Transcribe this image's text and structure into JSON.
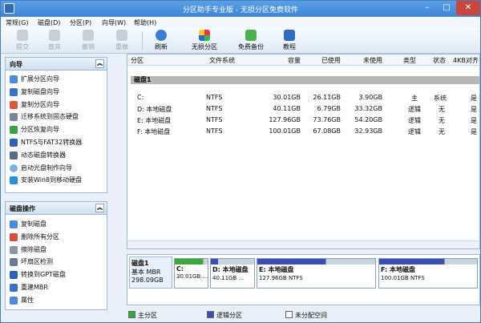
{
  "window": {
    "title": "分区助手专业版 - 无损分区免费软件"
  },
  "menu": [
    "常规(G)",
    "磁盘(D)",
    "分区(P)",
    "向导(W)",
    "帮助(H)"
  ],
  "toolbar": [
    {
      "label": "提交",
      "icon": "check-icon",
      "disabled": true
    },
    {
      "label": "放弃",
      "icon": "discard-icon",
      "disabled": true
    },
    {
      "label": "撤销",
      "icon": "undo-icon",
      "disabled": true
    },
    {
      "label": "重做",
      "icon": "redo-icon",
      "disabled": true
    },
    {
      "label": "刷新",
      "icon": "refresh-icon",
      "disabled": false
    },
    {
      "label": "无损分区",
      "icon": "partition-icon",
      "disabled": false
    },
    {
      "label": "免费备份",
      "icon": "backup-icon",
      "disabled": false
    },
    {
      "label": "教程",
      "icon": "tutorial-icon",
      "disabled": false
    }
  ],
  "wizard_panel": {
    "title": "向导",
    "items": [
      "扩展分区向导",
      "复制磁盘向导",
      "复制分区向导",
      "迁移系统到固态硬盘",
      "分区恢复向导",
      "NTFS与FAT32转换器",
      "动态磁盘转换器",
      "启动光盘制作向导",
      "安装Win8到移动硬盘"
    ]
  },
  "disk_panel": {
    "title": "磁盘操作",
    "items": [
      "复制磁盘",
      "删除所有分区",
      "擦除磁盘",
      "坏扇区检测",
      "转换到GPT磁盘",
      "重建MBR",
      "属性"
    ]
  },
  "table": {
    "columns": [
      "分区",
      "文件系统",
      "容量",
      "已使用",
      "未使用",
      "类型",
      "状态",
      "4KB对齐"
    ],
    "disk_label": "磁盘1",
    "rows": [
      {
        "name": "C:",
        "fs": "NTFS",
        "capacity": "30.01GB",
        "used": "26.11GB",
        "free": "3.90GB",
        "type": "主",
        "status": "系统",
        "align": "是"
      },
      {
        "name": "D: 本地磁盘",
        "fs": "NTFS",
        "capacity": "40.11GB",
        "used": "6.79GB",
        "free": "33.32GB",
        "type": "逻辑",
        "status": "无",
        "align": "是"
      },
      {
        "name": "E: 本地磁盘",
        "fs": "NTFS",
        "capacity": "127.96GB",
        "used": "73.76GB",
        "free": "54.20GB",
        "type": "逻辑",
        "status": "无",
        "align": "是"
      },
      {
        "name": "F: 本地磁盘",
        "fs": "NTFS",
        "capacity": "100.01GB",
        "used": "67.08GB",
        "free": "32.93GB",
        "type": "逻辑",
        "status": "无",
        "align": "是"
      }
    ]
  },
  "diskmap": {
    "disk": {
      "name": "磁盘1",
      "type": "基本 MBR",
      "size": "298.09GB"
    },
    "partitions": [
      {
        "label": "C:",
        "size": "30.01GB ...",
        "used_fraction": 0.87,
        "kind": "primary"
      },
      {
        "label": "D: 本地磁盘",
        "size": "40.11GB ...",
        "used_fraction": 0.17,
        "kind": "logical"
      },
      {
        "label": "E: 本地磁盘",
        "size": "127.96GB NTFS",
        "used_fraction": 0.58,
        "kind": "logical"
      },
      {
        "label": "F: 本地磁盘",
        "size": "100.01GB NTFS",
        "used_fraction": 0.67,
        "kind": "logical"
      }
    ]
  },
  "legend": [
    "主分区",
    "逻辑分区",
    "未分配空间"
  ],
  "colors": {
    "primary": "#3aa83a",
    "logical": "#3b4fb3",
    "unallocated": "#ffffff"
  }
}
